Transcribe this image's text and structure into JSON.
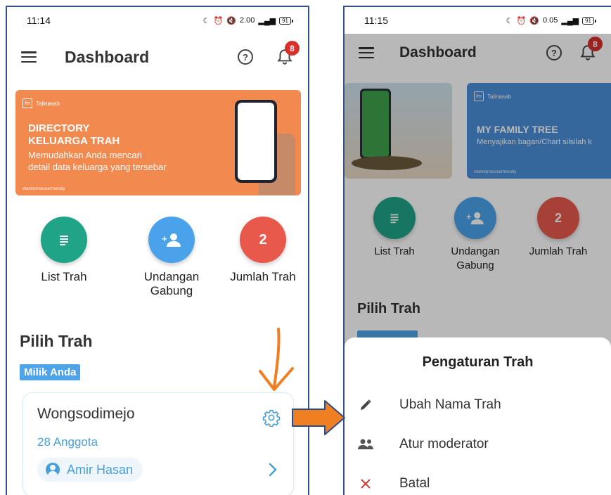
{
  "left": {
    "status": {
      "time": "11:14",
      "speed": "2.00",
      "battery": "91"
    },
    "appbar": {
      "title": "Dashboard",
      "help_glyph": "?",
      "notification_count": "8"
    },
    "banner": {
      "brand": "Talinasab",
      "brand_logo_text": "fm",
      "heading": "DIRECTORY\nKELUARGA TRAH",
      "subtitle": "Memudahkan Anda mencari\ndetail data keluarga yang tersebar",
      "hashtag": "#familytreeuserfriendly"
    },
    "actions": [
      {
        "label": "List Trah",
        "icon": "list-icon",
        "color": "#1fa487"
      },
      {
        "label": "Undangan\nGabung",
        "icon": "add-person-icon",
        "color": "#4aa3ea"
      },
      {
        "label": "Jumlah Trah",
        "value": "2",
        "color": "#e8594b"
      }
    ],
    "section_title": "Pilih Trah",
    "owned_label": "Milik Anda",
    "card": {
      "name": "Wongsodimejo",
      "members": "28 Anggota",
      "owner": "Amir Hasan"
    }
  },
  "right": {
    "status": {
      "time": "11:15",
      "speed": "0.05",
      "battery": "91"
    },
    "appbar": {
      "title": "Dashboard",
      "help_glyph": "?",
      "notification_count": "8"
    },
    "banner": {
      "brand": "Talinasab",
      "title": "MY FAMILY TREE",
      "subtitle": "Menyajikan bagan/Chart silsilah k",
      "hashtag": "#familytreeuserfriendly"
    },
    "actions": [
      {
        "label": "List Trah",
        "icon": "list-icon",
        "color": "#1fa487"
      },
      {
        "label": "Undangan\nGabung",
        "icon": "add-person-icon",
        "color": "#4aa3ea"
      },
      {
        "label": "Jumlah Trah",
        "value": "2",
        "color": "#e8594b"
      }
    ],
    "section_title": "Pilih Trah",
    "sheet": {
      "title": "Pengaturan Trah",
      "items": [
        {
          "label": "Ubah Nama Trah",
          "icon": "pencil-icon"
        },
        {
          "label": "Atur moderator",
          "icon": "people-icon"
        },
        {
          "label": "Batal",
          "icon": "close-icon"
        }
      ]
    }
  },
  "colors": {
    "accent": "#4a9fd9",
    "banner_orange": "#f2894f",
    "annotation_orange": "#f07f22",
    "frame": "#35508f"
  }
}
